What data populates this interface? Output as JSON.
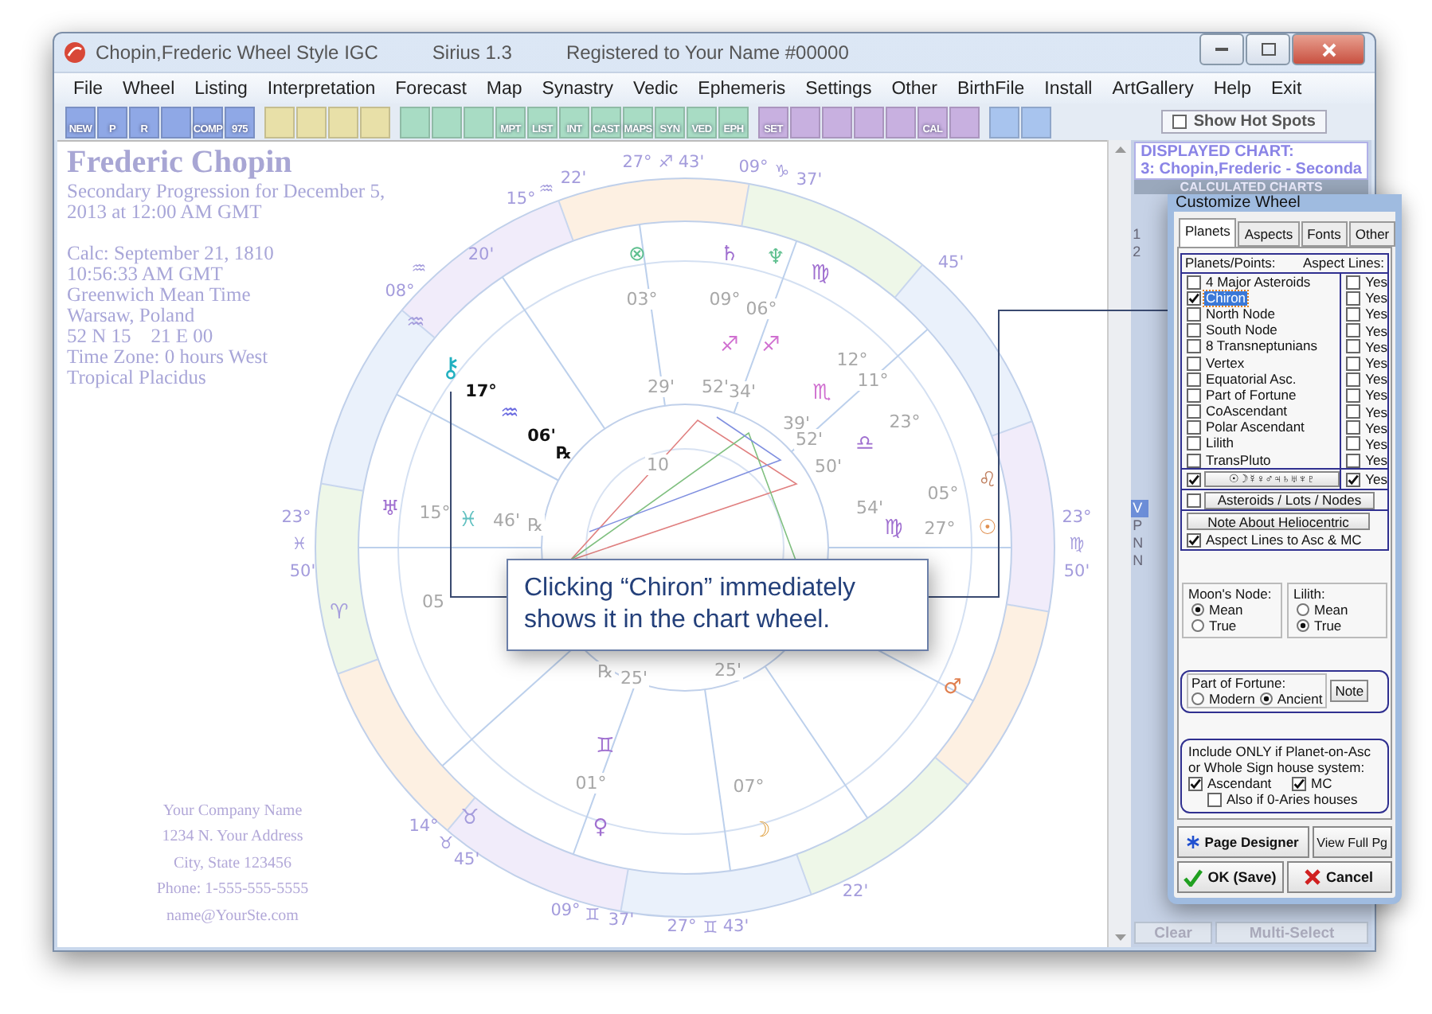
{
  "window": {
    "title": "Chopin,Frederic Wheel Style IGC",
    "version": "Sirius 1.3",
    "registration": "Registered to Your Name  #00000"
  },
  "menu": [
    "File",
    "Wheel",
    "Listing",
    "Interpretation",
    "Forecast",
    "Map",
    "Synastry",
    "Vedic",
    "Ephemeris",
    "Settings",
    "Other",
    "BirthFile",
    "Install",
    "ArtGallery",
    "Help",
    "Exit"
  ],
  "toolbar": {
    "groups": [
      {
        "color": "#8fa8e6",
        "items": [
          {
            "kind": "label",
            "label": "NEW"
          },
          {
            "kind": "label",
            "label": "P"
          },
          {
            "kind": "label",
            "label": "R"
          },
          {
            "kind": "icon"
          },
          {
            "kind": "label",
            "label": "COMP"
          },
          {
            "kind": "label",
            "label": "975"
          }
        ]
      },
      {
        "color": "#e8e0a8",
        "items": [
          {
            "kind": "icon"
          },
          {
            "kind": "icon"
          },
          {
            "kind": "icon"
          },
          {
            "kind": "icon"
          }
        ]
      },
      {
        "color": "#a8dcc4",
        "items": [
          {
            "kind": "icon"
          },
          {
            "kind": "icon"
          },
          {
            "kind": "icon"
          },
          {
            "kind": "label",
            "label": "MPT"
          },
          {
            "kind": "label",
            "label": "LIST"
          },
          {
            "kind": "label",
            "label": "INT"
          },
          {
            "kind": "label",
            "label": "CAST"
          },
          {
            "kind": "label",
            "label": "MAPS"
          },
          {
            "kind": "label",
            "label": "SYN"
          },
          {
            "kind": "label",
            "label": "VED"
          },
          {
            "kind": "label",
            "label": "EPH"
          }
        ]
      },
      {
        "color": "#c8b0e0",
        "items": [
          {
            "kind": "label",
            "label": "SET"
          },
          {
            "kind": "icon"
          },
          {
            "kind": "icon"
          },
          {
            "kind": "icon"
          },
          {
            "kind": "icon"
          },
          {
            "kind": "label",
            "label": "CAL"
          },
          {
            "kind": "icon"
          }
        ]
      },
      {
        "color": "#a8c4ee",
        "items": [
          {
            "kind": "icon"
          },
          {
            "kind": "icon"
          }
        ]
      }
    ],
    "hot_spots": {
      "label": "Show Hot Spots",
      "checked": false
    }
  },
  "chart_header": {
    "name": "Frederic Chopin",
    "chart_type": "Secondary Progression  for December 5, 2013 at 12:00 AM GMT",
    "details": [
      "Calc: September 21, 1810",
      "10:56:33 AM GMT",
      "Greenwich Mean Time",
      "Warsaw, Poland",
      "52 N 15    21 E 00",
      "Time Zone: 0 hours West",
      "Tropical Placidus"
    ]
  },
  "company": [
    "Your Company Name",
    "1234 N. Your Address",
    "City, State 123456",
    "Phone: 1-555-555-5555",
    "name@YourSte.com"
  ],
  "wheel": {
    "labels": [
      {
        "text": "27°",
        "kind": "cusp"
      },
      {
        "text": "♐",
        "kind": "cusp"
      },
      {
        "text": "43'",
        "kind": "cusp"
      },
      {
        "text": "09°",
        "kind": "cusp"
      },
      {
        "text": "♑",
        "kind": "cusp"
      },
      {
        "text": "37'",
        "kind": "cusp"
      },
      {
        "text": "15°",
        "kind": "cusp"
      },
      {
        "text": "♒",
        "kind": "cusp"
      },
      {
        "text": "22'",
        "kind": "cusp"
      },
      {
        "text": "20'",
        "kind": "cusp"
      },
      {
        "text": "♒",
        "kind": "cusp"
      },
      {
        "text": "08°",
        "kind": "cusp"
      },
      {
        "text": "♒",
        "kind": "sign"
      },
      {
        "text": "45'",
        "kind": "cusp"
      },
      {
        "text": "23°",
        "kind": "cusp"
      },
      {
        "text": "♓",
        "kind": "cusp"
      },
      {
        "text": "50'",
        "kind": "cusp"
      },
      {
        "text": "23°",
        "kind": "cusp"
      },
      {
        "text": "♍",
        "kind": "cusp"
      },
      {
        "text": "50'",
        "kind": "cusp"
      },
      {
        "text": "14°",
        "kind": "cusp"
      },
      {
        "text": "♉",
        "kind": "cusp"
      },
      {
        "text": "45'",
        "kind": "cusp"
      },
      {
        "text": "09°",
        "kind": "cusp"
      },
      {
        "text": "♊",
        "kind": "cusp"
      },
      {
        "text": "37'",
        "kind": "cusp"
      },
      {
        "text": "27°",
        "kind": "cusp"
      },
      {
        "text": "♊",
        "kind": "cusp"
      },
      {
        "text": "43'",
        "kind": "cusp"
      },
      {
        "text": "22'",
        "kind": "cusp"
      },
      {
        "text": "♈",
        "kind": "sign"
      },
      {
        "text": "♉",
        "kind": "sign"
      },
      {
        "text": "⚷",
        "kind": "chiron"
      },
      {
        "text": "17°",
        "kind": "focus"
      },
      {
        "text": "♒",
        "kind": "glyph",
        "color": "#6a6ae0"
      },
      {
        "text": "06'",
        "kind": "focus"
      },
      {
        "text": "℞",
        "kind": "focus"
      },
      {
        "text": "⊗",
        "kind": "glyph",
        "color": "#60c090"
      },
      {
        "text": "♄",
        "kind": "glyph",
        "color": "#a070d0"
      },
      {
        "text": "♆",
        "kind": "glyph",
        "color": "#60c090"
      },
      {
        "text": "♍",
        "kind": "glyph",
        "color": "#a070d0"
      },
      {
        "text": "03°",
        "kind": "degree"
      },
      {
        "text": "09°",
        "kind": "degree"
      },
      {
        "text": "06°",
        "kind": "degree"
      },
      {
        "text": "29'",
        "kind": "degree"
      },
      {
        "text": "52'",
        "kind": "degree"
      },
      {
        "text": "34'",
        "kind": "degree"
      },
      {
        "text": "♐",
        "kind": "glyph",
        "color": "#d070d0"
      },
      {
        "text": "♐",
        "kind": "glyph",
        "color": "#d070d0"
      },
      {
        "text": "12°",
        "kind": "degree"
      },
      {
        "text": "11°",
        "kind": "degree"
      },
      {
        "text": "♏",
        "kind": "glyph",
        "color": "#d070d0"
      },
      {
        "text": "♎",
        "kind": "glyph",
        "color": "#a070d0"
      },
      {
        "text": "39'",
        "kind": "degree"
      },
      {
        "text": "52'",
        "kind": "degree"
      },
      {
        "text": "50'",
        "kind": "degree"
      },
      {
        "text": "23°",
        "kind": "degree"
      },
      {
        "text": "05°",
        "kind": "degree"
      },
      {
        "text": "♌",
        "kind": "glyph",
        "color": "#c08060"
      },
      {
        "text": "27°",
        "kind": "degree"
      },
      {
        "text": "☉",
        "kind": "glyph",
        "color": "#e09050"
      },
      {
        "text": "54'",
        "kind": "degree"
      },
      {
        "text": "♍",
        "kind": "glyph",
        "color": "#a070d0"
      },
      {
        "text": "♅",
        "kind": "glyph",
        "color": "#a070d0"
      },
      {
        "text": "15°",
        "kind": "degree"
      },
      {
        "text": "♓",
        "kind": "glyph",
        "color": "#60c0c0"
      },
      {
        "text": "46'",
        "kind": "degree"
      },
      {
        "text": "℞",
        "kind": "degree"
      },
      {
        "text": "05",
        "kind": "degree"
      },
      {
        "text": "10",
        "kind": "degree"
      },
      {
        "text": "℞",
        "kind": "degree"
      },
      {
        "text": "25'",
        "kind": "degree"
      },
      {
        "text": "25'",
        "kind": "degree"
      },
      {
        "text": "♊",
        "kind": "glyph",
        "color": "#a070d0"
      },
      {
        "text": "01°",
        "kind": "degree"
      },
      {
        "text": "♀",
        "kind": "glyph",
        "color": "#a070d0"
      },
      {
        "text": "07°",
        "kind": "degree"
      },
      {
        "text": "☽",
        "kind": "glyph",
        "color": "#e0a040"
      },
      {
        "text": "♂",
        "kind": "glyph",
        "color": "#e08050"
      }
    ]
  },
  "side_panel": {
    "displayed_title": "DISPLAYED CHART:",
    "displayed_chart": "3: Chopin,Frederic - Seconda",
    "calculated_title": "CALCULATED CHARTS",
    "rows": [
      {
        "label": "1",
        "selected": false
      },
      {
        "label": "2",
        "selected": false
      }
    ],
    "items": [
      {
        "label": "V",
        "selected": true
      },
      {
        "label": "P",
        "selected": false
      },
      {
        "label": "N",
        "selected": false
      },
      {
        "label": "N",
        "selected": false
      }
    ],
    "buttons": [
      "Clear",
      "Multi-Select"
    ]
  },
  "dialog": {
    "title": "Customize Wheel",
    "tabs": [
      {
        "label": "Planets",
        "selected": true
      },
      {
        "label": "Aspects",
        "selected": false
      },
      {
        "label": "Fonts",
        "selected": false
      },
      {
        "label": "Other",
        "selected": false
      }
    ],
    "points_header": "Planets/Points:",
    "aspects_header": "Aspect Lines:",
    "points": [
      {
        "label": "4 Major Asteroids",
        "checked": false,
        "selected": false,
        "aspect": "Yes",
        "aspect_checked": false
      },
      {
        "label": "Chiron",
        "checked": true,
        "selected": true,
        "aspect": "Yes",
        "aspect_checked": false
      },
      {
        "label": "North Node",
        "checked": false,
        "selected": false,
        "aspect": "Yes",
        "aspect_checked": false
      },
      {
        "label": "South Node",
        "checked": false,
        "selected": false,
        "aspect": "Yes",
        "aspect_checked": false
      },
      {
        "label": "8 Transneptunians",
        "checked": false,
        "selected": false,
        "aspect": "Yes",
        "aspect_checked": false
      },
      {
        "label": "Vertex",
        "checked": false,
        "selected": false,
        "aspect": "Yes",
        "aspect_checked": false
      },
      {
        "label": "Equatorial Asc.",
        "checked": false,
        "selected": false,
        "aspect": "Yes",
        "aspect_checked": false
      },
      {
        "label": "Part of Fortune",
        "checked": false,
        "selected": false,
        "aspect": "Yes",
        "aspect_checked": false
      },
      {
        "label": "CoAscendant",
        "checked": false,
        "selected": false,
        "aspect": "Yes",
        "aspect_checked": false
      },
      {
        "label": "Polar Ascendant",
        "checked": false,
        "selected": false,
        "aspect": "Yes",
        "aspect_checked": false
      },
      {
        "label": "Lilith",
        "checked": false,
        "selected": false,
        "aspect": "Yes",
        "aspect_checked": false
      },
      {
        "label": "TransPluto",
        "checked": false,
        "selected": false,
        "aspect": "Yes",
        "aspect_checked": false
      }
    ],
    "planets_row": {
      "label": "☉☽☿♀♂♃♄♅♆♇",
      "checked": true,
      "aspect": "Yes",
      "aspect_checked": true
    },
    "asteroids_row": {
      "label": "Asteroids / Lots / Nodes",
      "checked": false
    },
    "helio_button": "Note About Heliocentric",
    "asc_mc": {
      "label": "Aspect Lines to Asc & MC",
      "checked": true
    },
    "moons_node": {
      "title": "Moon's Node:",
      "options": [
        {
          "label": "Mean",
          "selected": true
        },
        {
          "label": "True",
          "selected": false
        }
      ]
    },
    "lilith": {
      "title": "Lilith:",
      "options": [
        {
          "label": "Mean",
          "selected": false
        },
        {
          "label": "True",
          "selected": true
        }
      ]
    },
    "fortune": {
      "title": "Part of Fortune:",
      "options": [
        {
          "label": "Modern",
          "selected": false
        },
        {
          "label": "Ancient",
          "selected": true
        }
      ],
      "note_button": "Note"
    },
    "include": {
      "text": "Include ONLY if Planet-on-Asc or Whole Sign house system:",
      "ascendant": {
        "label": "Ascendant",
        "checked": true
      },
      "mc": {
        "label": "MC",
        "checked": true
      },
      "aries": {
        "label": "Also if 0-Aries houses",
        "checked": false
      }
    },
    "page_designer": "Page Designer",
    "view_full": "View Full Pg",
    "ok": "OK (Save)",
    "cancel": "Cancel"
  },
  "callout": {
    "text": "Clicking “Chiron” immediately shows it in the chart wheel."
  }
}
